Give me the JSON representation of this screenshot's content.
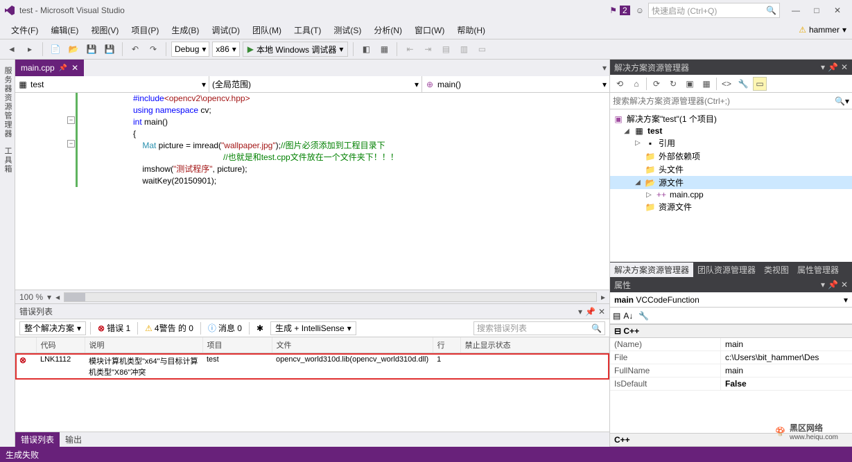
{
  "title": "test - Microsoft Visual Studio",
  "notif_count": "2",
  "quicklaunch_placeholder": "快速启动 (Ctrl+Q)",
  "user": "hammer",
  "menu": [
    "文件(F)",
    "编辑(E)",
    "视图(V)",
    "项目(P)",
    "生成(B)",
    "调试(D)",
    "团队(M)",
    "工具(T)",
    "测试(S)",
    "分析(N)",
    "窗口(W)",
    "帮助(H)"
  ],
  "toolbar": {
    "config": "Debug",
    "platform": "x86",
    "run_label": "本地 Windows 调试器"
  },
  "left_rail": [
    "服务器资源管理器",
    "工具箱"
  ],
  "doc_tab": "main.cpp",
  "nav": {
    "scope1": "test",
    "scope2": "(全局范围)",
    "scope3": "main()"
  },
  "code": {
    "l1a": "#include",
    "l1b": "<opencv2\\opencv.hpp>",
    "l2a": "using namespace",
    "l2b": " cv;",
    "l3a": "int",
    "l3b": " main()",
    "l4": "{",
    "l5a": "    Mat",
    "l5b": " picture = imread(",
    "l5c": "\"wallpaper.jpg\"",
    "l5d": ");",
    "l5e": "//图片必须添加到工程目录下",
    "l6": "                                       //也就是和test.cpp文件放在一个文件夹下！！！",
    "l7a": "    imshow(",
    "l7b": "\"测试程序\"",
    "l7c": ", picture);",
    "l8": "    waitKey(20150901);"
  },
  "zoom": "100 %",
  "errorlist": {
    "title": "错误列表",
    "filter_scope": "整个解决方案",
    "errors_label": "错误 1",
    "warnings_label": "4警告 的 0",
    "messages_label": "消息 0",
    "build_filter": "生成 + IntelliSense",
    "search_placeholder": "搜索错误列表",
    "cols": [
      "",
      "代码",
      "说明",
      "项目",
      "文件",
      "行",
      "禁止显示状态"
    ],
    "row": {
      "code": "LNK1112",
      "desc": "模块计算机类型\"x64\"与目标计算机类型\"X86\"冲突",
      "project": "test",
      "file": "opencv_world310d.lib(opencv_world310d.dll)",
      "line": "1"
    }
  },
  "bottom_tabs": [
    "错误列表",
    "输出"
  ],
  "solution": {
    "title": "解决方案资源管理器",
    "search_placeholder": "搜索解决方案资源管理器(Ctrl+;)",
    "root": "解决方案\"test\"(1 个项目)",
    "project": "test",
    "items": [
      "引用",
      "外部依赖项",
      "头文件",
      "源文件",
      "main.cpp",
      "资源文件"
    ]
  },
  "right_tabs": [
    "解决方案资源管理器",
    "团队资源管理器",
    "类视图",
    "属性管理器"
  ],
  "properties": {
    "title": "属性",
    "object": "main VCCodeFunction",
    "cat": "C++",
    "rows": [
      {
        "k": "(Name)",
        "v": "main"
      },
      {
        "k": "File",
        "v": "c:\\Users\\bit_hammer\\Des"
      },
      {
        "k": "FullName",
        "v": "main"
      },
      {
        "k": "IsDefault",
        "v": "False"
      }
    ],
    "desc_cat": "C++"
  },
  "status": "生成失败",
  "watermark": {
    "t1": "黑区网络",
    "t2": "www.heiqu.com"
  }
}
